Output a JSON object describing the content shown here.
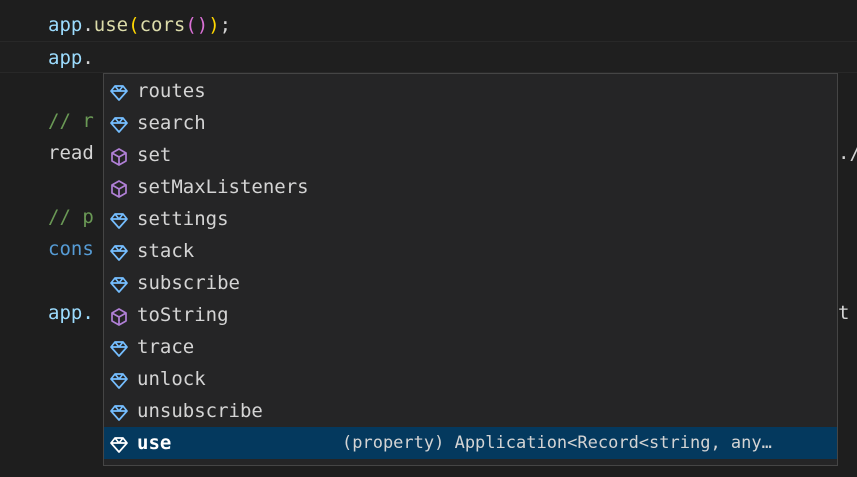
{
  "editor": {
    "lines": [
      {
        "tokens": [
          {
            "t": "app",
            "c": "tok-ident"
          },
          {
            "t": ".",
            "c": "tok-punc"
          },
          {
            "t": "use",
            "c": "tok-fn"
          },
          {
            "t": "(",
            "c": "tok-paren1"
          },
          {
            "t": "cors",
            "c": "tok-fn"
          },
          {
            "t": "()",
            "c": "tok-paren2"
          },
          {
            "t": ")",
            "c": "tok-paren1"
          },
          {
            "t": ";",
            "c": "tok-punc"
          }
        ]
      },
      {
        "current": true,
        "tokens": [
          {
            "t": "app",
            "c": "tok-ident"
          },
          {
            "t": ".",
            "c": "tok-punc"
          }
        ]
      },
      {
        "tokens": []
      },
      {
        "tokens": [
          {
            "t": "// r",
            "c": "tok-comment"
          }
        ]
      },
      {
        "tokens": [
          {
            "t": "read",
            "c": "tok-plain"
          }
        ],
        "right": {
          "t": "./",
          "c": "tok-plain"
        }
      },
      {
        "tokens": []
      },
      {
        "tokens": [
          {
            "t": "// p",
            "c": "tok-comment"
          }
        ]
      },
      {
        "tokens": [
          {
            "t": "cons",
            "c": "tok-keyword"
          }
        ]
      },
      {
        "tokens": []
      },
      {
        "tokens": [
          {
            "t": "app.",
            "c": "tok-ident"
          }
        ],
        "right": {
          "t": "t",
          "c": "tok-plain"
        }
      }
    ]
  },
  "suggest": {
    "items": [
      {
        "label": "routes",
        "kind": "property",
        "color": "#75beff"
      },
      {
        "label": "search",
        "kind": "property",
        "color": "#75beff"
      },
      {
        "label": "set",
        "kind": "method",
        "color": "#b180d7"
      },
      {
        "label": "setMaxListeners",
        "kind": "method",
        "color": "#b180d7"
      },
      {
        "label": "settings",
        "kind": "property",
        "color": "#75beff"
      },
      {
        "label": "stack",
        "kind": "property",
        "color": "#75beff"
      },
      {
        "label": "subscribe",
        "kind": "property",
        "color": "#75beff"
      },
      {
        "label": "toString",
        "kind": "method",
        "color": "#b180d7"
      },
      {
        "label": "trace",
        "kind": "property",
        "color": "#75beff"
      },
      {
        "label": "unlock",
        "kind": "property",
        "color": "#75beff"
      },
      {
        "label": "unsubscribe",
        "kind": "property",
        "color": "#75beff"
      },
      {
        "label": "use",
        "kind": "property",
        "color": "#ffffff",
        "selected": true,
        "detail": "(property) Application<Record<string, any…"
      }
    ]
  }
}
